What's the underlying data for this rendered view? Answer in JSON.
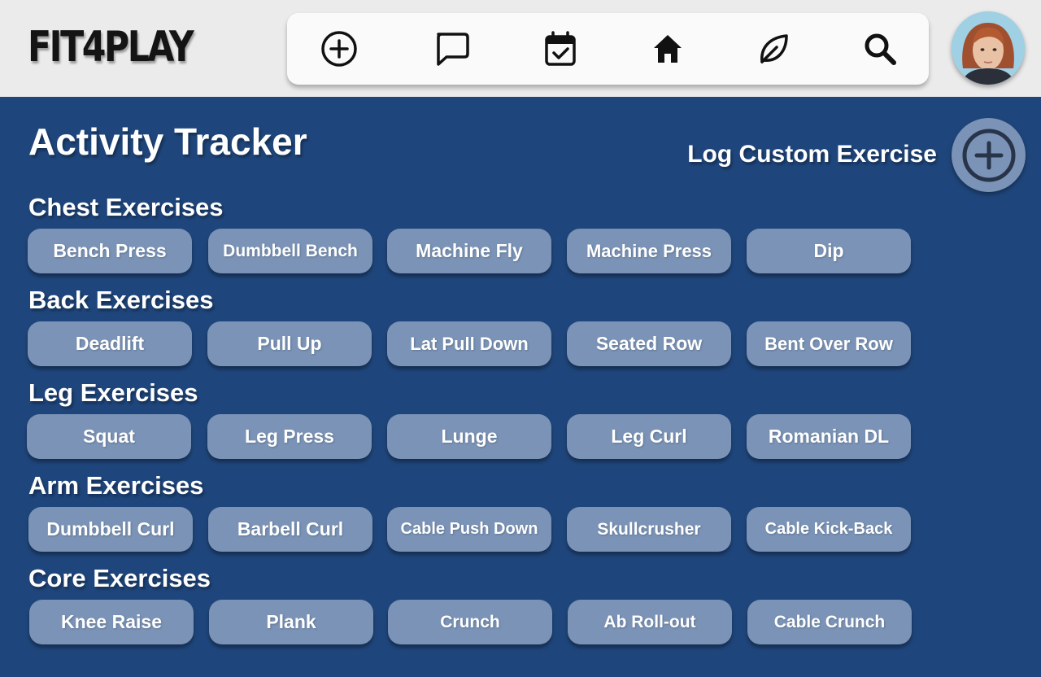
{
  "header": {
    "logo": "FIT4PLAY",
    "nav_icons": [
      "plus-circle-icon",
      "chat-bubble-icon",
      "calendar-check-icon",
      "home-icon",
      "leaf-icon",
      "search-icon"
    ]
  },
  "main": {
    "title": "Activity Tracker",
    "log_custom_label": "Log Custom Exercise",
    "sections": [
      {
        "title": "Chest Exercises",
        "items": [
          "Bench Press",
          "Dumbbell Bench",
          "Machine Fly",
          "Machine Press",
          "Dip"
        ]
      },
      {
        "title": "Back Exercises",
        "items": [
          "Deadlift",
          "Pull Up",
          "Lat Pull Down",
          "Seated Row",
          "Bent Over Row"
        ]
      },
      {
        "title": "Leg Exercises",
        "items": [
          "Squat",
          "Leg Press",
          "Lunge",
          "Leg Curl",
          "Romanian DL"
        ]
      },
      {
        "title": "Arm Exercises",
        "items": [
          "Dumbbell Curl",
          "Barbell Curl",
          "Cable Push Down",
          "Skullcrusher",
          "Cable Kick-Back"
        ]
      },
      {
        "title": "Core Exercises",
        "items": [
          "Knee Raise",
          "Plank",
          "Crunch",
          "Ab Roll-out",
          "Cable Crunch"
        ]
      }
    ]
  },
  "colors": {
    "background": "#1f467c",
    "header_bg": "#ebebeb",
    "chip_bg": "#7a93b6",
    "text": "#ffffff"
  }
}
